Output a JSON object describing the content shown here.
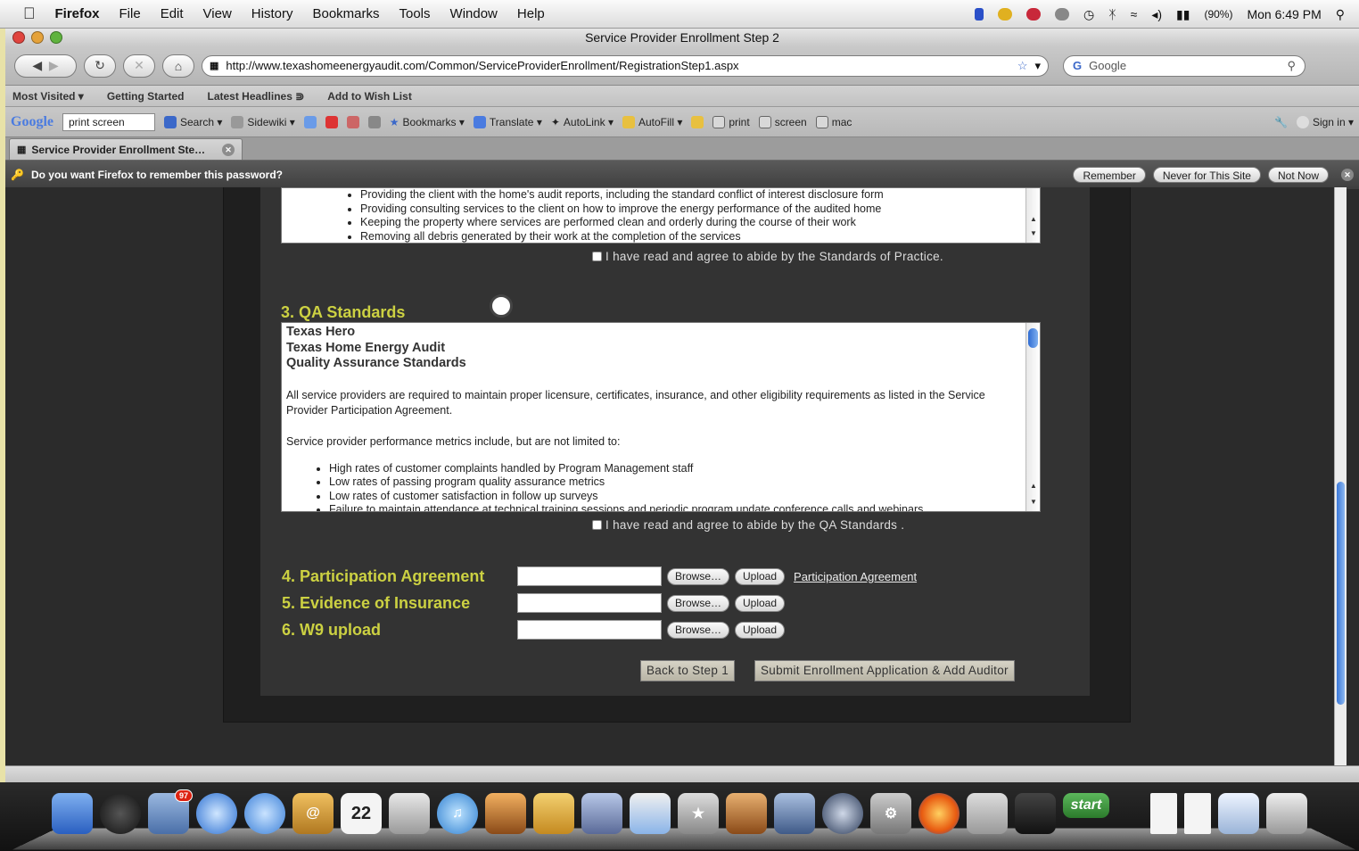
{
  "menubar": {
    "items": [
      "Firefox",
      "File",
      "Edit",
      "View",
      "History",
      "Bookmarks",
      "Tools",
      "Window",
      "Help"
    ],
    "battery": "(90%)",
    "clock": "Mon 6:49 PM"
  },
  "window": {
    "title": "Service Provider Enrollment Step 2",
    "url": "http://www.texashomeenergyaudit.com/Common/ServiceProviderEnrollment/RegistrationStep1.aspx",
    "search_placeholder": "Google"
  },
  "bookmarks_bar": [
    "Most Visited ▾",
    "Getting Started",
    "Latest Headlines ⋑",
    "Add to Wish List"
  ],
  "google_toolbar": {
    "logo": "Google",
    "query": "print screen",
    "items": [
      "Search ▾",
      "Sidewiki ▾",
      "Bookmarks ▾",
      "Translate ▾",
      "AutoLink ▾",
      "AutoFill ▾",
      "print",
      "screen",
      "mac"
    ],
    "sign_in": "Sign in ▾"
  },
  "tab": {
    "title": "Service Provider Enrollment Ste…"
  },
  "password_bar": {
    "message": "Do you want Firefox to remember this password?",
    "buttons": [
      "Remember",
      "Never for This Site",
      "Not Now"
    ]
  },
  "standards_of_practice": {
    "bullets": [
      "Providing the client with the home's audit reports, including the standard conflict of interest disclosure form",
      "Providing consulting services to the client on how to improve the energy performance of the audited home",
      "Keeping the property where services are performed clean and orderly during the course of their work",
      "Removing all debris generated by their work at the completion of the services"
    ],
    "agree_label": "I have read and agree to abide by the Standards of Practice."
  },
  "qa_standards": {
    "heading": "3. QA Standards",
    "title_lines": [
      "Texas Hero",
      "Texas Home Energy Audit",
      "Quality Assurance Standards"
    ],
    "paragraph1": "All service providers are required to maintain proper licensure, certificates, insurance, and other eligibility requirements as listed in the Service Provider Participation Agreement.",
    "paragraph2": "Service provider performance metrics include, but are not limited to:",
    "bullets": [
      "High rates of customer complaints handled by Program Management staff",
      "Low rates of passing program quality assurance metrics",
      "Low rates of customer satisfaction in follow up surveys",
      "Failure to maintain attendance at technical training sessions and periodic program update conference calls and webinars"
    ],
    "agree_label": "I have read and agree to abide by the QA Standards ."
  },
  "uploads": [
    {
      "label": "4. Participation Agreement",
      "browse": "Browse…",
      "upload": "Upload",
      "link": "Participation Agreement"
    },
    {
      "label": "5. Evidence of Insurance",
      "browse": "Browse…",
      "upload": "Upload"
    },
    {
      "label": "6. W9 upload",
      "browse": "Browse…",
      "upload": "Upload"
    }
  ],
  "actions": {
    "back": "Back to Step 1",
    "submit": "Submit Enrollment Application & Add Auditor"
  },
  "dock": {
    "ical_date": "22",
    "mail_badge": "97",
    "start_label": "start"
  }
}
